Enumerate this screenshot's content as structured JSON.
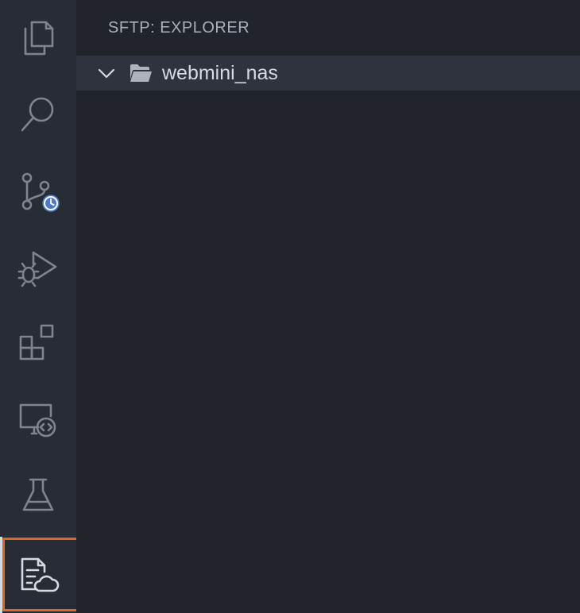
{
  "activity_bar": {
    "items": [
      {
        "name": "explorer",
        "icon": "files-icon"
      },
      {
        "name": "search",
        "icon": "search-icon"
      },
      {
        "name": "source-control",
        "icon": "source-control-icon",
        "badge_icon": "clock-icon"
      },
      {
        "name": "run-debug",
        "icon": "run-debug-icon"
      },
      {
        "name": "extensions",
        "icon": "extensions-icon"
      },
      {
        "name": "remote-explorer",
        "icon": "remote-explorer-icon"
      },
      {
        "name": "testing",
        "icon": "flask-icon"
      },
      {
        "name": "sftp",
        "icon": "sftp-file-cloud-icon",
        "active": true
      }
    ]
  },
  "sidebar": {
    "title": "SFTP: EXPLORER",
    "tree": [
      {
        "label": "webmini_nas",
        "expanded": true,
        "icon": "folder-open-icon"
      }
    ]
  },
  "colors": {
    "activity_bar_bg": "#282c34",
    "sidebar_bg": "#21252b",
    "selected_row_bg": "#2f333d",
    "badge_blue": "#4d78cc",
    "highlight_orange": "#d8692b"
  }
}
